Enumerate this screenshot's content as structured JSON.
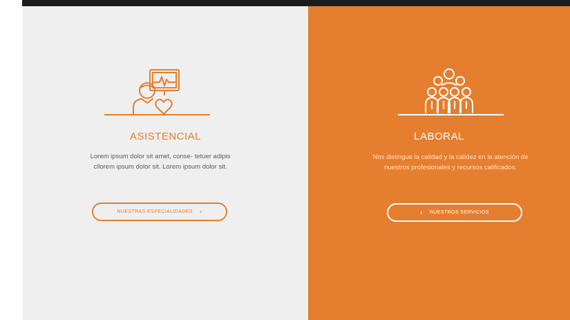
{
  "colors": {
    "accent": "#e57e2e",
    "light_panel": "#efefef",
    "top_bar": "#1b1b1b"
  },
  "left_card": {
    "icon": "doctor-heart-monitor-icon",
    "title": "ASISTENCIAL",
    "description": "Lorem ipsum dolor sit amet, conse- tetuer adipis cilorem ipsum dolor sit. Lorem ipsum dolor sit.",
    "button_label": "NUESTRAS ESPECIALIDADES",
    "button_chevron": "›"
  },
  "right_card": {
    "icon": "team-group-icon",
    "title": "LABORAL",
    "description": "Nos distingue la calidad y la calidez en la atención de nuestros profesionales y recursos calificados.",
    "button_label": "NUESTROS SERVICIOS",
    "button_chevron": "‹"
  }
}
